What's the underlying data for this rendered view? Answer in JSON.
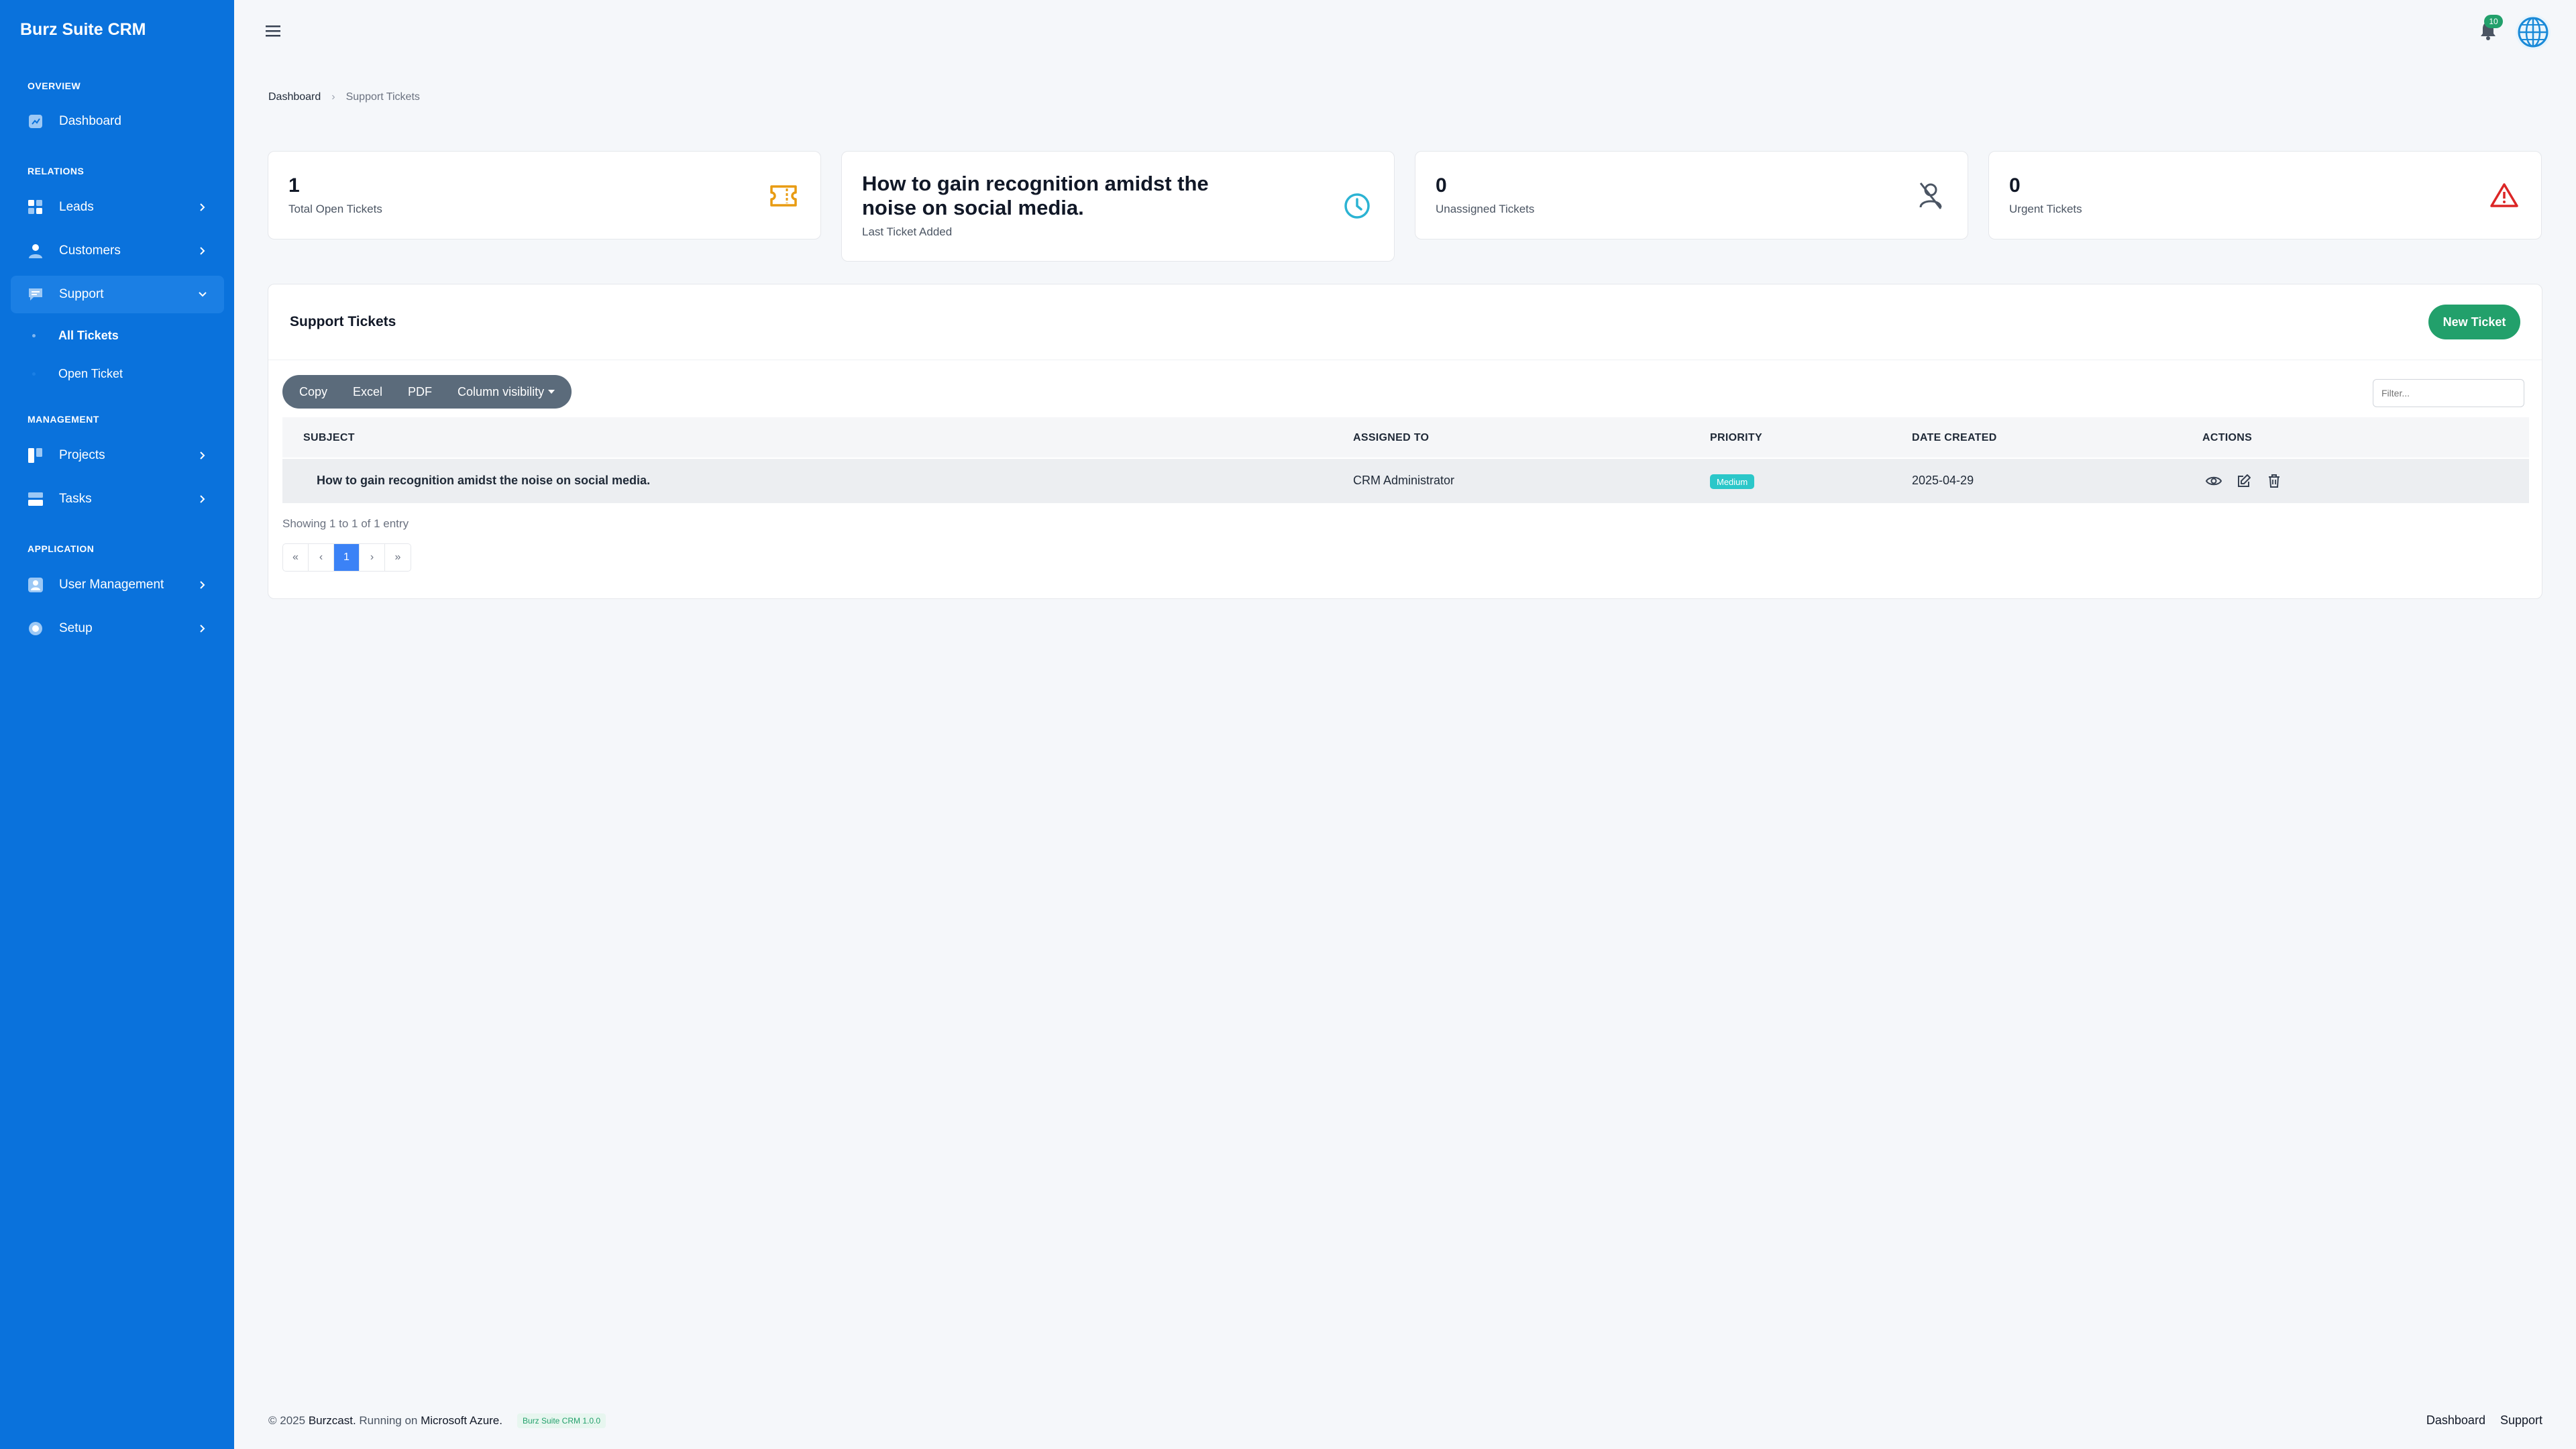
{
  "brand": "Burz Suite CRM",
  "sidebar": {
    "sections": {
      "overview": "OVERVIEW",
      "relations": "RELATIONS",
      "management": "MANAGEMENT",
      "application": "APPLICATION"
    },
    "items": {
      "dashboard": "Dashboard",
      "leads": "Leads",
      "customers": "Customers",
      "support": "Support",
      "all_tickets": "All Tickets",
      "open_ticket": "Open Ticket",
      "projects": "Projects",
      "tasks": "Tasks",
      "user_management": "User Management",
      "setup": "Setup"
    }
  },
  "topbar": {
    "notification_count": "10"
  },
  "breadcrumb": {
    "home": "Dashboard",
    "current": "Support Tickets"
  },
  "stats": {
    "open": {
      "value": "1",
      "label": "Total Open Tickets"
    },
    "last": {
      "value": "How to gain recognition amidst the noise on social media.",
      "label": "Last Ticket Added"
    },
    "unassigned": {
      "value": "0",
      "label": "Unassigned Tickets"
    },
    "urgent": {
      "value": "0",
      "label": "Urgent Tickets"
    }
  },
  "panel": {
    "title": "Support Tickets",
    "new_button": "New Ticket",
    "export_buttons": {
      "copy": "Copy",
      "excel": "Excel",
      "pdf": "PDF",
      "columns": "Column visibility"
    },
    "filter_placeholder": "Filter...",
    "columns": {
      "subject": "SUBJECT",
      "assigned": "ASSIGNED TO",
      "priority": "PRIORITY",
      "date": "DATE CREATED",
      "actions": "ACTIONS"
    },
    "rows": [
      {
        "subject": "How to gain recognition amidst the noise on social media.",
        "assigned": "CRM Administrator",
        "priority": "Medium",
        "date": "2025-04-29"
      }
    ],
    "info": "Showing 1 to 1 of 1 entry",
    "pager": {
      "first": "«",
      "prev": "‹",
      "current": "1",
      "next": "›",
      "last": "»"
    }
  },
  "footer": {
    "copyright": "© 2025",
    "company": "Burzcast.",
    "running": "Running on",
    "platform": "Microsoft Azure.",
    "version": "Burz Suite CRM 1.0.0",
    "links": {
      "dashboard": "Dashboard",
      "support": "Support"
    }
  },
  "colors": {
    "sidebar": "#0a72dc",
    "accent_green": "#22a06b",
    "ticket_icon": "#e89b12",
    "clock_icon": "#2bb3d3",
    "warning_icon": "#dc2626"
  }
}
